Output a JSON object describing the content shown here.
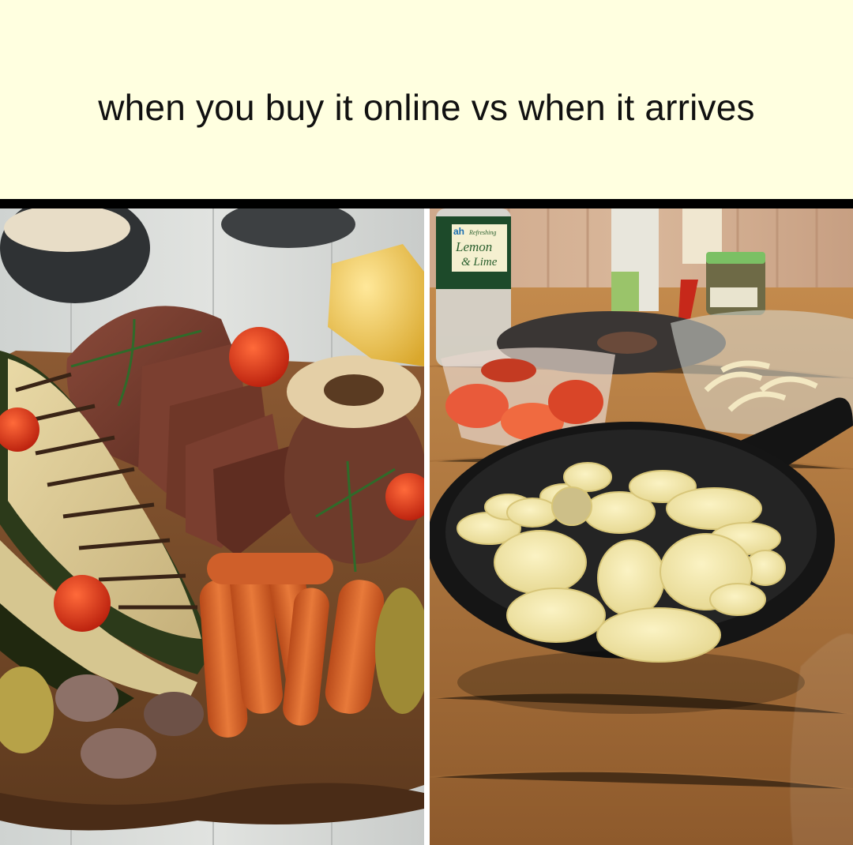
{
  "caption": {
    "text": "when you buy it online vs when it arrives"
  },
  "photos": {
    "left": {
      "subject": "online-photo-roast-platter"
    },
    "right": {
      "subject": "delivered-photo-fried-potatoes-pan"
    },
    "bottle_label": {
      "brand": "ah",
      "line1": "Refreshing",
      "line2": "Lemon",
      "line3": "& Lime"
    }
  },
  "colors": {
    "caption_background": "#ffffe0",
    "caption_text": "#111111",
    "border": "#000000"
  }
}
